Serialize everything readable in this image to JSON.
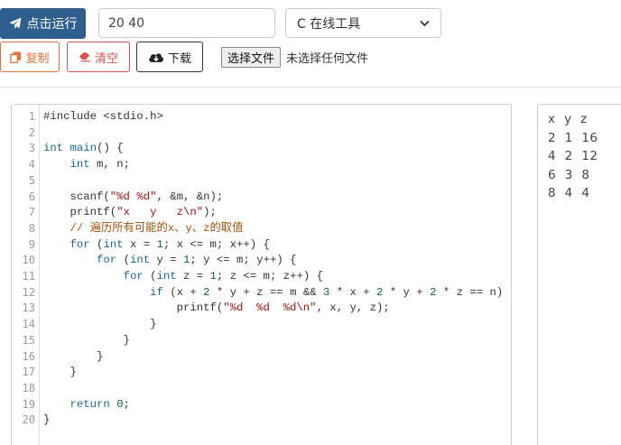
{
  "toolbar": {
    "run_label": "点击运行",
    "stdin_value": "20 40",
    "language_selected": "C 在线工具",
    "copy_label": "复制",
    "clear_label": "清空",
    "download_label": "下载",
    "file_button_label": "选择文件",
    "file_status": "未选择任何文件"
  },
  "editor": {
    "line_numbers": [
      "1",
      "2",
      "3",
      "4",
      "5",
      "6",
      "7",
      "8",
      "9",
      "10",
      "11",
      "12",
      "13",
      "14",
      "15",
      "16",
      "17",
      "18",
      "19",
      "20"
    ]
  },
  "output": {
    "lines": [
      "x  y  z",
      "2  1  16",
      "4  2  12",
      "6  3  8",
      "8  4  4"
    ]
  },
  "colors": {
    "run_button": "#2f5f8f",
    "copy_button": "#e8703a",
    "clear_button": "#d9534f",
    "keyword": "#1a6a8a",
    "string": "#a11",
    "comment": "#a0520b"
  }
}
